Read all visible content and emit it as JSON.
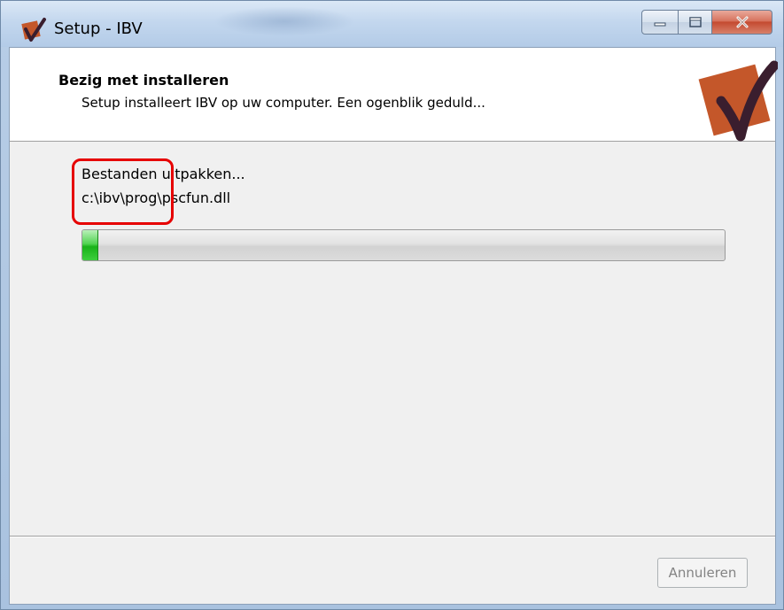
{
  "window": {
    "title": "Setup - IBV",
    "icon": "ibv-logo-icon"
  },
  "caption_buttons": {
    "minimize_icon": "minimize-icon",
    "maximize_icon": "maximize-icon",
    "close_icon": "close-icon"
  },
  "header": {
    "title": "Bezig met installeren",
    "subtitle": "Setup installeert IBV op uw computer. Een ogenblik geduld...",
    "logo": "ibv-checkmark-logo"
  },
  "status": {
    "action": "Bestanden uitpakken...",
    "file_path": "c:\\ibv\\prog\\pscfun.dll"
  },
  "progress": {
    "fraction": 0.025
  },
  "footer": {
    "cancel_label": "Annuleren"
  },
  "colors": {
    "annotation_highlight": "#e60000",
    "progress_fill": "#19b219",
    "logo_orange": "#c4572a",
    "logo_dark": "#3a1e2e"
  }
}
